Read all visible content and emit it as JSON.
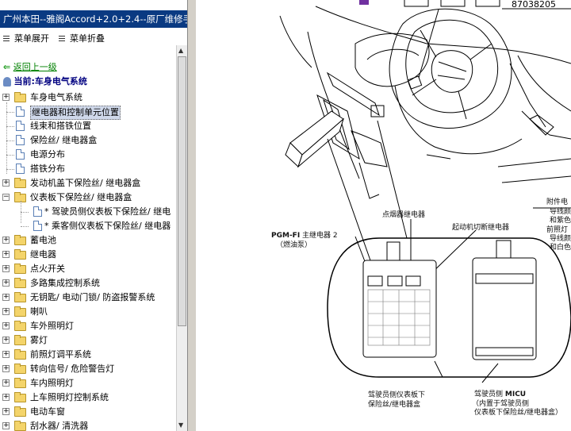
{
  "window": {
    "title": "广州本田--雅阁Accord+2.0+2.4--原厂维修手"
  },
  "menu": {
    "expand_label": "菜单展开",
    "collapse_label": "菜单折叠"
  },
  "nav": {
    "back_label": "返回上一级",
    "current_label": "当前:车身电气系统"
  },
  "tree": {
    "items": [
      {
        "label": "车身电气系统",
        "type": "folder",
        "expander": "+"
      },
      {
        "label": "继电器和控制单元位置",
        "type": "doc",
        "selected": true
      },
      {
        "label": "线束和搭铁位置",
        "type": "doc"
      },
      {
        "label": "保险丝/ 继电器盒",
        "type": "doc"
      },
      {
        "label": "电源分布",
        "type": "doc"
      },
      {
        "label": "搭铁分布",
        "type": "doc"
      },
      {
        "label": "发动机盖下保险丝/ 继电器盒",
        "type": "folder",
        "expander": "+"
      },
      {
        "label": "仪表板下保险丝/ 继电器盒",
        "type": "folder-open",
        "expander": "−"
      },
      {
        "label": "* 驾驶员侧仪表板下保险丝/ 继电",
        "type": "doc-child"
      },
      {
        "label": "* 乘客侧仪表板下保险丝/ 继电器",
        "type": "doc-child"
      },
      {
        "label": "蓄电池",
        "type": "folder",
        "expander": "+"
      },
      {
        "label": "继电器",
        "type": "folder",
        "expander": "+"
      },
      {
        "label": "点火开关",
        "type": "folder",
        "expander": "+"
      },
      {
        "label": "多路集成控制系统",
        "type": "folder",
        "expander": "+"
      },
      {
        "label": "无钥匙/ 电动门锁/ 防盗报警系统",
        "type": "folder",
        "expander": "+"
      },
      {
        "label": "喇叭",
        "type": "folder",
        "expander": "+"
      },
      {
        "label": "车外照明灯",
        "type": "folder",
        "expander": "+"
      },
      {
        "label": "雾灯",
        "type": "folder",
        "expander": "+"
      },
      {
        "label": "前照灯调平系统",
        "type": "folder",
        "expander": "+"
      },
      {
        "label": "转向信号/ 危险警告灯",
        "type": "folder",
        "expander": "+"
      },
      {
        "label": "车内照明灯",
        "type": "folder",
        "expander": "+"
      },
      {
        "label": "上车照明灯控制系统",
        "type": "folder",
        "expander": "+"
      },
      {
        "label": "电动车窗",
        "type": "folder",
        "expander": "+"
      },
      {
        "label": "刮水器/ 清洗器",
        "type": "folder",
        "expander": "+"
      }
    ]
  },
  "diagram": {
    "code": "87038205",
    "labels": {
      "pgm_fi": "PGM-FI",
      "pgm_fi_tail": "主继电器 2",
      "fuel_pump": "（燃油泵）",
      "ignition_relay": "点烟器继电器",
      "starter_relay": "起动机切断继电器",
      "driver_box_1": "驾驶员侧仪表板下",
      "driver_box_2": "保险丝/继电器盒",
      "micu_prefix": "驾驶员侧",
      "micu": "MICU",
      "micu_note_1": "（内置于驾驶员侧",
      "micu_note_2": "仪表板下保险丝/继电器盒）",
      "side_1": "附件电",
      "side_2": "导线颜",
      "side_3": "和紫色",
      "side_4": "前照灯",
      "side_5": "导线颜",
      "side_6": "和白色"
    }
  },
  "colors": {
    "titlebar": "#0a3a82",
    "link": "#008000",
    "current": "#000080"
  }
}
